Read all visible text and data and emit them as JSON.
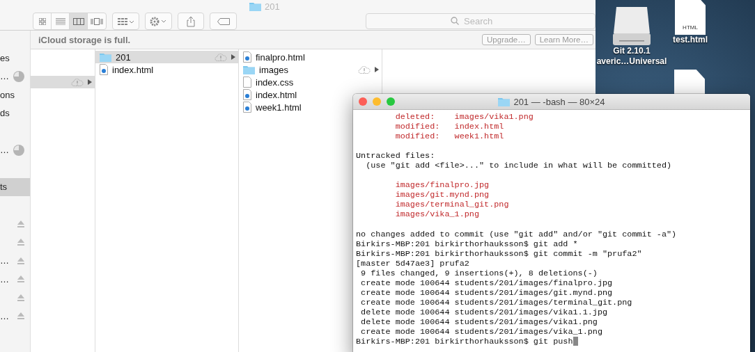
{
  "finder": {
    "title": "201",
    "search": {
      "placeholder": "Search"
    },
    "banner": {
      "message": "iCloud storage is full.",
      "buttons": [
        "Upgrade…",
        "Learn More…"
      ]
    },
    "sidebar": {
      "sections": [
        {
          "items": [
            {
              "label": "es",
              "kind": "plain",
              "selected": false
            },
            {
              "label": "…",
              "kind": "progress",
              "selected": false
            },
            {
              "label": "ons",
              "kind": "plain",
              "selected": false
            },
            {
              "label": "ds",
              "kind": "plain",
              "selected": false
            }
          ]
        },
        {
          "items": [
            {
              "label": "…",
              "kind": "progress",
              "selected": false
            }
          ]
        },
        {
          "items": [
            {
              "label": "ts",
              "kind": "plain",
              "selected": true
            }
          ]
        },
        {
          "items": [
            {
              "kind": "eject",
              "selected": false
            },
            {
              "kind": "eject",
              "selected": false
            },
            {
              "label": "…",
              "kind": "eject",
              "selected": false
            },
            {
              "label": "…",
              "kind": "eject",
              "selected": false
            },
            {
              "kind": "eject",
              "selected": false
            },
            {
              "label": "…",
              "kind": "eject",
              "selected": false
            }
          ]
        }
      ]
    },
    "columns": [
      {
        "items": [
          {
            "selected": true,
            "cloud": true,
            "arrow": true
          }
        ]
      },
      {
        "items": [
          {
            "name": "201",
            "kind": "folder",
            "selected": true,
            "cloud": true,
            "arrow": true
          },
          {
            "name": "index.html",
            "kind": "html",
            "selected": false,
            "cloud": false,
            "arrow": false
          }
        ]
      },
      {
        "items": [
          {
            "name": "finalpro.html",
            "kind": "html",
            "selected": false,
            "cloud": false,
            "arrow": false
          },
          {
            "name": "images",
            "kind": "folder",
            "selected": false,
            "cloud": true,
            "arrow": true
          },
          {
            "name": "index.css",
            "kind": "text",
            "selected": false,
            "cloud": false,
            "arrow": false
          },
          {
            "name": "index.html",
            "kind": "html",
            "selected": false,
            "cloud": false,
            "arrow": false
          },
          {
            "name": "week1.html",
            "kind": "html",
            "selected": false,
            "cloud": false,
            "arrow": false
          }
        ]
      }
    ]
  },
  "desktop": {
    "icons": [
      {
        "kind": "drive",
        "label_lines": [
          "Git 2.10.1",
          "averic…Universal"
        ]
      },
      {
        "kind": "html-file",
        "badge": "HTML",
        "label_lines": [
          "test.html"
        ]
      },
      {
        "kind": "blank-file"
      }
    ]
  },
  "terminal": {
    "title": "201 — -bash — 80×24",
    "lines": [
      {
        "text": "        deleted:    images/vika1.png",
        "kind": "changed"
      },
      {
        "text": "        modified:   index.html",
        "kind": "changed"
      },
      {
        "text": "        modified:   week1.html",
        "kind": "changed"
      },
      {
        "kind": "blank"
      },
      {
        "text": "Untracked files:",
        "kind": "plain"
      },
      {
        "text": "  (use \"git add <file>...\" to include in what will be committed)",
        "kind": "plain"
      },
      {
        "kind": "blank"
      },
      {
        "text": "        images/finalpro.jpg",
        "kind": "changed"
      },
      {
        "text": "        images/git.mynd.png",
        "kind": "changed"
      },
      {
        "text": "        images/terminal_git.png",
        "kind": "changed"
      },
      {
        "text": "        images/vika_1.png",
        "kind": "changed"
      },
      {
        "kind": "blank"
      },
      {
        "text": "no changes added to commit (use \"git add\" and/or \"git commit -a\")",
        "kind": "plain"
      },
      {
        "text": "Birkirs-MBP:201 birkirthorhauksson$ git add *",
        "kind": "plain"
      },
      {
        "text": "Birkirs-MBP:201 birkirthorhauksson$ git commit -m \"prufa2\"",
        "kind": "plain"
      },
      {
        "text": "[master 5d47ae3] prufa2",
        "kind": "plain"
      },
      {
        "text": " 9 files changed, 9 insertions(+), 8 deletions(-)",
        "kind": "plain"
      },
      {
        "text": " create mode 100644 students/201/images/finalpro.jpg",
        "kind": "plain"
      },
      {
        "text": " create mode 100644 students/201/images/git.mynd.png",
        "kind": "plain"
      },
      {
        "text": " create mode 100644 students/201/images/terminal_git.png",
        "kind": "plain"
      },
      {
        "text": " delete mode 100644 students/201/images/vika1.1.jpg",
        "kind": "plain"
      },
      {
        "text": " delete mode 100644 students/201/images/vika1.png",
        "kind": "plain"
      },
      {
        "text": " create mode 100644 students/201/images/vika_1.png",
        "kind": "plain"
      },
      {
        "text": "Birkirs-MBP:201 birkirthorhauksson$ git push",
        "kind": "plain",
        "cursor": true
      }
    ]
  }
}
